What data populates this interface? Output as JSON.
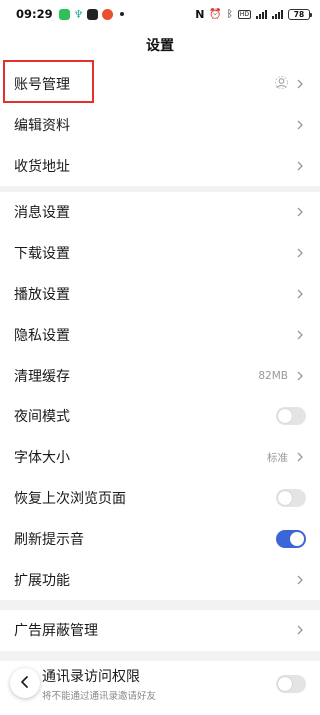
{
  "status_bar": {
    "time": "09:29",
    "nfc": "N",
    "hd": "HD",
    "battery": "78"
  },
  "header": {
    "title": "设置"
  },
  "group1": [
    {
      "label": "账号管理",
      "type": "link",
      "icon": "user-ring-icon",
      "highlighted": true
    },
    {
      "label": "编辑资料",
      "type": "link"
    },
    {
      "label": "收货地址",
      "type": "link"
    }
  ],
  "group2": [
    {
      "label": "消息设置",
      "type": "link"
    },
    {
      "label": "下载设置",
      "type": "link"
    },
    {
      "label": "播放设置",
      "type": "link"
    },
    {
      "label": "隐私设置",
      "type": "link"
    },
    {
      "label": "清理缓存",
      "type": "value",
      "value": "82MB"
    },
    {
      "label": "夜间模式",
      "type": "toggle",
      "on": false
    },
    {
      "label": "字体大小",
      "type": "value",
      "value": "标准"
    },
    {
      "label": "恢复上次浏览页面",
      "type": "toggle",
      "on": false
    },
    {
      "label": "刷新提示音",
      "type": "toggle",
      "on": true
    },
    {
      "label": "扩展功能",
      "type": "link"
    }
  ],
  "group3": [
    {
      "label": "广告屏蔽管理",
      "type": "link"
    }
  ],
  "group4": [
    {
      "label": "通讯录访问权限",
      "sublabel": "将不能通过通讯录邀请好友",
      "type": "toggle",
      "on": false
    }
  ],
  "colors": {
    "accent": "#3b66d8",
    "highlight": "#e4322b",
    "background": "#f2f2f2"
  }
}
